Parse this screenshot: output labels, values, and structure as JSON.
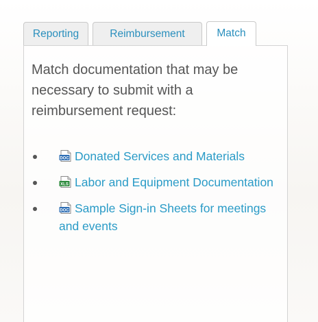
{
  "tabs": [
    {
      "label": "Reporting",
      "active": false
    },
    {
      "label": "Reimbursement",
      "active": false
    },
    {
      "label": "Match",
      "active": true
    }
  ],
  "panel": {
    "intro": "Match documentation that may be necessary to submit with a reimbursement request:",
    "documents": [
      {
        "label": "Donated Services and Materials",
        "icon": "doc-file-icon",
        "icon_text": "DOC"
      },
      {
        "label": "Labor and Equipment Documentation",
        "icon": "xls-file-icon",
        "icon_text": "XLS"
      },
      {
        "label": "Sample Sign-in Sheets for meetings and events",
        "icon": "doc-file-icon",
        "icon_text": "DOC"
      }
    ]
  },
  "colors": {
    "link": "#2a9bc7",
    "text": "#555555",
    "doc_icon": "#2f6fb5",
    "xls_icon": "#2e8b3e"
  }
}
